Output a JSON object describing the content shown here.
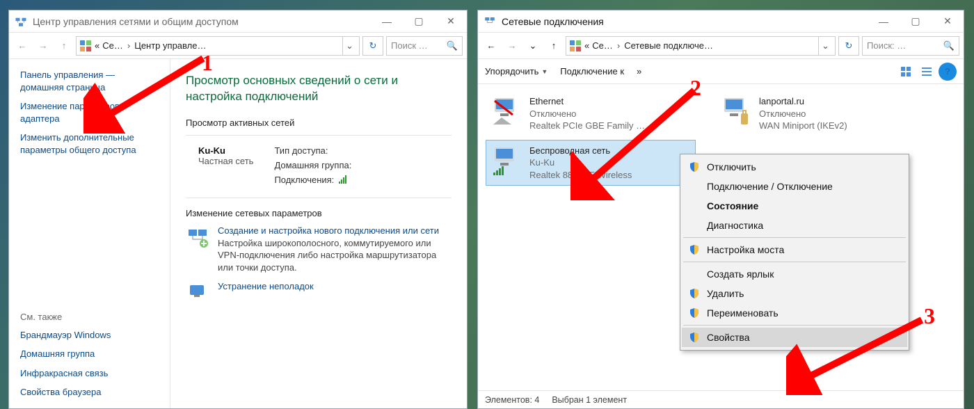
{
  "left": {
    "title": "Центр управления сетями и общим доступом",
    "breadcrumb": {
      "root": "Се…",
      "current": "Центр управле…"
    },
    "search_placeholder": "Поиск …",
    "side": {
      "home": "Панель управления — домашняя страница",
      "link_adapter": "Изменение параметров адаптера",
      "link_sharing": "Изменить дополнительные параметры общего доступа",
      "see_also": "См. также",
      "firewall": "Брандмауэр Windows",
      "homegroup": "Домашняя группа",
      "infrared": "Инфракрасная связь",
      "browser_props": "Свойства браузера"
    },
    "main": {
      "heading": "Просмотр основных сведений о сети и настройка подключений",
      "active_nets_title": "Просмотр активных сетей",
      "net_name": "Ku-Ku",
      "net_type": "Частная сеть",
      "kv_access": "Тип доступа:",
      "kv_homegroup": "Домашняя группа:",
      "kv_conn": "Подключения:",
      "change_title": "Изменение сетевых параметров",
      "task1_link": "Создание и настройка нового подключения или сети",
      "task1_desc": "Настройка широкополосного, коммутируемого или VPN-подключения либо настройка маршрутизатора или точки доступа.",
      "task2_link": "Устранение неполадок"
    }
  },
  "right": {
    "title": "Сетевые подключения",
    "breadcrumb": {
      "root": "Се…",
      "current": "Сетевые подключе…"
    },
    "search_placeholder": "Поиск: …",
    "toolbar": {
      "organize": "Упорядочить",
      "connect_to": "Подключение к",
      "more": "»"
    },
    "connections": [
      {
        "name": "Ethernet",
        "status": "Отключено",
        "device": "Realtek PCIe GBE Family …"
      },
      {
        "name": "lanportal.ru",
        "status": "Отключено",
        "device": "WAN Miniport (IKEv2)"
      },
      {
        "name": "Беспроводная сеть",
        "status": "Ku-Ku",
        "device": "Realtek 8821AE Wireless"
      }
    ],
    "context_menu": {
      "disable": "Отключить",
      "connect": "Подключение / Отключение",
      "status": "Состояние",
      "diag": "Диагностика",
      "bridge": "Настройка моста",
      "shortcut": "Создать ярлык",
      "delete": "Удалить",
      "rename": "Переименовать",
      "props": "Свойства"
    },
    "statusbar": {
      "count": "Элементов: 4",
      "selected": "Выбран 1 элемент"
    }
  },
  "annotations": {
    "n1": "1",
    "n2": "2",
    "n3": "3"
  }
}
